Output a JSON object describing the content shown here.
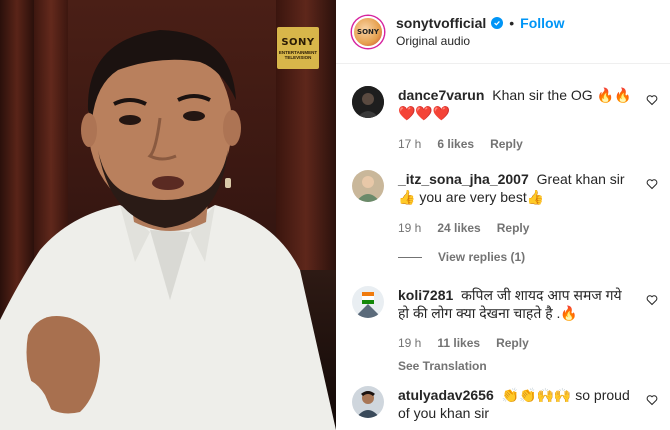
{
  "channel_logo": {
    "brand": "SONY",
    "sub": "ENTERTAINMENT TELEVISION"
  },
  "header": {
    "username": "sonytvofficial",
    "follow_label": "Follow",
    "separator": "•",
    "audio": "Original audio",
    "avatar_text": "SONY"
  },
  "comments": [
    {
      "user": "dance7varun",
      "text": "Khan sir the OG 🔥🔥",
      "line2": "❤️❤️❤️",
      "time": "17 h",
      "likes": "6 likes",
      "reply": "Reply"
    },
    {
      "user": "_itz_sona_jha_2007",
      "text": "Great khan sir👍 you are very best👍",
      "time": "19 h",
      "likes": "24 likes",
      "reply": "Reply"
    },
    {
      "user": "koli7281",
      "text": "कपिल जी शायद आप समज गये हो की लोग क्या देखना चाहते है .🔥",
      "time": "19 h",
      "likes": "11 likes",
      "reply": "Reply",
      "see_translation": "See Translation"
    },
    {
      "user": "atulyadav2656",
      "text": "👏👏🙌🙌 so proud of you khan sir"
    }
  ],
  "view_replies": "View replies (1)",
  "colors": {
    "accent": "#0095f6",
    "text": "#262626",
    "muted": "#737373"
  }
}
